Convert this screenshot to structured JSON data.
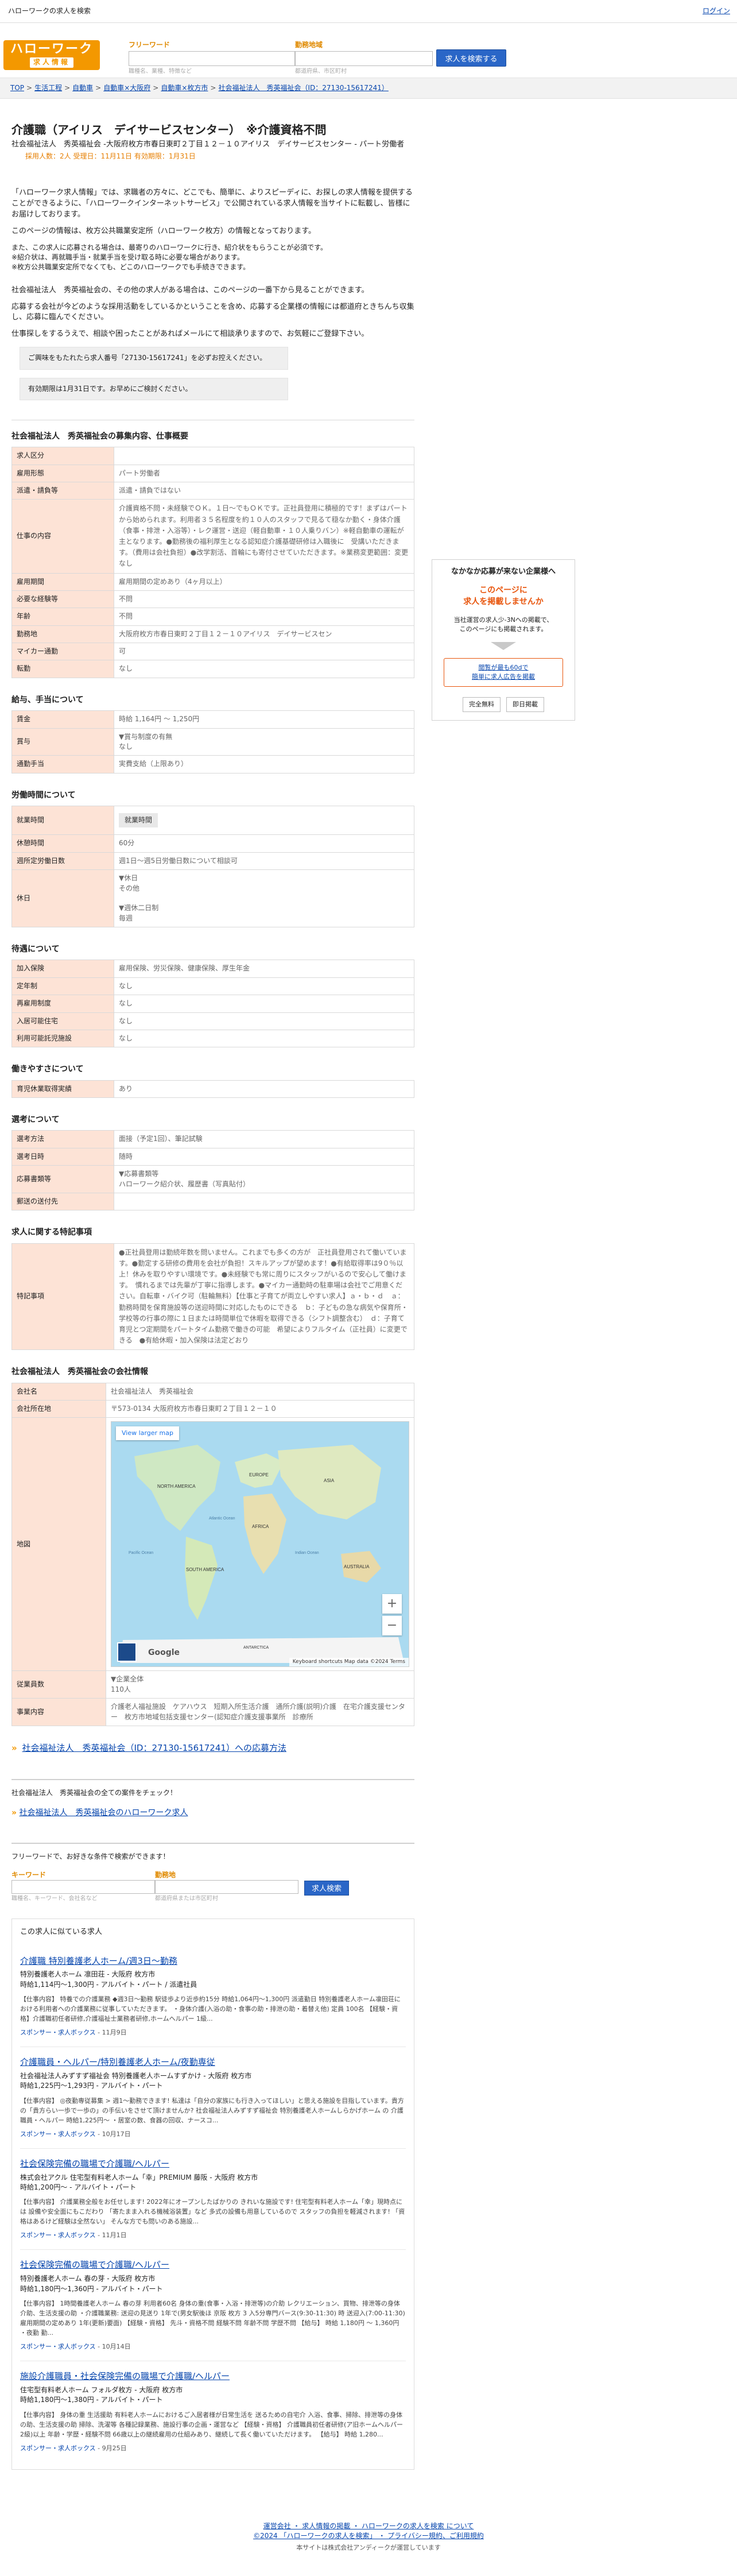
{
  "topbar": {
    "site_title": "ハローワークの求人を検索",
    "login": "ログイン"
  },
  "header": {
    "logo_line1": "ハローワーク",
    "logo_line2": "求人情報",
    "keyword_label": "フリーワード",
    "keyword_hint": "職種名、業種、特徴など",
    "area_label": "勤務地域",
    "area_hint": "都道府県、市区町村",
    "search_button": "求人を検索する"
  },
  "breadcrumb": [
    "TOP",
    "生活工程",
    "自動車",
    "自動車×大阪府",
    "自動車×枚方市",
    "社会福祉法人　秀英福祉会（ID：27130-15617241）"
  ],
  "job": {
    "title": "介護職（アイリス　デイサービスセンター）　※介護資格不問",
    "employer": "社会福祉法人　秀英福祉会 -大阪府枚方市春日東町２丁目１２－１０アイリス　デイサービスセンター - パート労働者",
    "meta_label": "採用人数：2人",
    "meta_dates": "受理日：11月11日  有効期限：1月31日"
  },
  "notice": {
    "p1": "「ハローワーク求人情報」では、求職者の方々に、どこでも、簡単に、よりスピーディに、お探しの求人情報を提供することができるように、「ハローワークインターネットサービス」で公開されている求人情報を当サイトに転載し、皆様にお届けしております。",
    "p2": "このページの情報は、枚方公共職業安定所（ハローワーク枚方）の情報となっております。",
    "p3": "また、この求人に応募される場合は、最寄りのハローワークに行き、紹介状をもらうことが必須です。",
    "p4": "※紹介状は、再就職手当・就業手当を受け取る時に必要な場合があります。",
    "p5": "※枚方公共職業安定所でなくても、どこのハローワークでも手続きできます。",
    "p6": "社会福祉法人　秀英福祉会の、その他の求人がある場合は、このページの一番下から見ることができます。",
    "p7": "応募する会社が今どのような採用活動をしているかということを含め、応募する企業様の情報には都道府ときちんち収集し、応募に臨んでください。",
    "p8": "仕事探しをするうえで、相談や困ったことがあればメールにて相談承りますので、お気軽にご登録下さい。",
    "box1": "ご興味をもたれたら求人番号「27130-15617241」を必ずお控えください。",
    "box2": "有効期限は1月31日です。お早めにご検討ください。"
  },
  "sections": {
    "overview_title": "社会福祉法人　秀英福祉会の募集内容、仕事概要",
    "overview": [
      {
        "k": "求人区分",
        "v": ""
      },
      {
        "k": "雇用形態",
        "v": "パート労働者"
      },
      {
        "k": "派遣・請負等",
        "v": "派遣・請負ではない"
      },
      {
        "k": "仕事の内容",
        "v": "介護資格不問・未経験でＯＫ。１日～でもＯＫです。正社員登用に積極的です！まずはパートから始められます。利用者３５名程度を約１０人のスタッフで見るて穏なか勤く・身体介護（食事・排泄・入浴等）・レク運営・送迎（軽自動車・１０人乗りバン）※軽自動車の運転が主となります。●勤務後の福利厚生となる認知症介護基礎研修は入職後に　受講いただきます。（費用は会社負担）●改学割活、首輪にも寄付させていただきます。※業務変更範囲：変更なし"
      },
      {
        "k": "雇用期間",
        "v": "雇用期間の定めあり（4ヶ月以上）"
      },
      {
        "k": "必要な経験等",
        "v": "不問"
      },
      {
        "k": "年齢",
        "v": "不問"
      },
      {
        "k": "勤務地",
        "v": "大阪府枚方市春日東町２丁目１２－１０アイリス　デイサービスセン"
      },
      {
        "k": "マイカー通勤",
        "v": "可"
      },
      {
        "k": "転勤",
        "v": "なし"
      }
    ],
    "pay_title": "給与、手当について",
    "pay": [
      {
        "k": "賃金",
        "v": "時給 1,164円 〜 1,250円"
      },
      {
        "k": "賞与",
        "v": "▼賞与制度の有無\nなし"
      },
      {
        "k": "通勤手当",
        "v": "実費支給（上限あり）"
      }
    ],
    "work_title": "労働時間について",
    "work": [
      {
        "k": "就業時間",
        "v": "就業時間"
      },
      {
        "k": "休憩時間",
        "v": "60分"
      },
      {
        "k": "週所定労働日数",
        "v": "週1日〜週5日労働日数について相談可"
      },
      {
        "k": "休日",
        "v": "▼休日\nその他\n\n▼週休二日制\n毎週"
      }
    ],
    "benefit_title": "待遇について",
    "benefit": [
      {
        "k": "加入保険",
        "v": "雇用保険、労災保険、健康保険、厚生年金"
      },
      {
        "k": "定年制",
        "v": "なし"
      },
      {
        "k": "再雇用制度",
        "v": "なし"
      },
      {
        "k": "入居可能住宅",
        "v": "なし"
      },
      {
        "k": "利用可能託児施設",
        "v": "なし"
      }
    ],
    "env_title": "働きやすさについて",
    "env": [
      {
        "k": "育児休業取得実績",
        "v": "あり"
      }
    ],
    "select_title": "選考について",
    "select": [
      {
        "k": "選考方法",
        "v": "面接（予定1回）、筆記試験"
      },
      {
        "k": "選考日時",
        "v": "随時"
      },
      {
        "k": "応募書類等",
        "v": "▼応募書類等\nハローワーク紹介状、履歴書（写真貼付）"
      },
      {
        "k": "郵送の送付先",
        "v": ""
      }
    ],
    "special_title": "求人に関する特記事項",
    "special": [
      {
        "k": "特記事項",
        "v": "●正社員登用は勤続年数を問いません。これまでも多くの方が　正社員登用されて働いています。●勤定する研修の費用を会社が負担！スキルアップが望めます！●有給取得率は9０％以上！休みを取りやすい環境です。●未経験でも常に周りにスタッフがいるので安心して働けます。　慣れるまでは先輩が丁寧に指導します。●マイカー通勤時の駐車場は会社でご用意ください。自転車・バイク可（駐輪無料）【仕事と子育てが両立しやすい求人】ａ・ｂ・ｄ　ａ：勤務時間を保育施設等の送迎時間に対応したものにできる　ｂ：子どもの急な病気や保育所・学校等の行事の際に１日または時間単位で休暇を取得できる（シフト調整含む）　ｄ：子育て育児とつ定期間をパートタイム勤務で働きの可能　希望によりフルタイム（正社員）に変更できる　●有給休暇・加入保険は法定どおり"
      }
    ],
    "company_title": "社会福祉法人　秀英福祉会の会社情報",
    "company": [
      {
        "k": "会社名",
        "v": "社会福祉法人　秀英福祉会"
      },
      {
        "k": "会社所在地",
        "v": "〒573-0134 大阪府枚方市春日東町２丁目１２－１０"
      },
      {
        "k": "地図",
        "v": ""
      },
      {
        "k": "従業員数",
        "v": "▼企業全体\n110人"
      },
      {
        "k": "事業内容",
        "v": "介護老人福祉施設　ケアハウス　短期入所生活介護　通所介護(説明)介護　在宅介護支援センター　枚方市地域包括支援センター(認知症介護支援事業所　診療所"
      }
    ]
  },
  "map": {
    "view_larger": "View larger map",
    "zoom_in": "+",
    "zoom_out": "−",
    "google": "Google",
    "footer": "Keyboard shortcuts   Map data ©2024   Terms",
    "labels": {
      "north_america": "NORTH AMERICA",
      "europe": "EUROPE",
      "asia": "ASIA",
      "africa": "AFRICA",
      "south_america": "SOUTH AMERICA",
      "australia": "AUSTRALIA",
      "antarctica": "ANTARCTICA",
      "atlantic": "Atlantic Ocean",
      "pacific": "Pacific Ocean",
      "indian": "Indian Ocean"
    }
  },
  "apply_link": "社会福祉法人　秀英福祉会（ID：27130-15617241）への応募方法",
  "company_other": {
    "cap": "社会福祉法人　秀英福祉会の全ての案件をチェック！",
    "link": "社会福祉法人　秀英福祉会のハローワーク求人"
  },
  "search2": {
    "cap": "フリーワードで、お好きな条件で検索ができます！",
    "kw_label": "キーワード",
    "kw_hint": "職種名、キーワード、会社名など",
    "area_label": "勤務地",
    "area_hint": "都道府県または市区町村",
    "button": "求人検索"
  },
  "similar": {
    "cap": "この求人に似ている求人",
    "jobs": [
      {
        "title": "介護職 特別養護老人ホーム/週3日〜勤務",
        "company": "特別養護老人ホーム 凛田荘 - 大阪府 枚方市",
        "salary": "時給1,114円〜1,300円 - アルバイト・パート / 派遣社員",
        "desc": "【仕事内容】 特養での介護業務 ◆週3日〜勤務 駅徒歩より近歩約15分 時給1,064円〜1,300円 派遣勤日 特別養護老人ホーム凛田荘における利用者への介護業務に従事していただきます。 ・身体介護(入浴の助・食事の助・排泄の助・着替え他) 定員 100名 【経験・資格】介護職初任者研修,介護福祉士業務者研修,ホームヘルパー 1級...",
        "sponsor": "スポンサー・",
        "source": "求人ボックス",
        "date": "- 11月9日"
      },
      {
        "title": "介護職員・ヘルパー/特別養護老人ホーム/夜勤専従",
        "company": "社会福祉法人みずすず福祉会 特別養護老人ホームすずかけ - 大阪府 枚方市",
        "salary": "時給1,225円〜1,293円 - アルバイト・パート",
        "desc": "【仕事内容】 ◎夜勤専従募集 > 週1〜勤務できます! 私達は「自分の家族にも行き入ってほしい」と思える施設を目指しています。貴方の「貴方らい一歩で一歩の」の手伝いをさせて頂けませんか? 社会福祉法人みずすず福祉会 特別養護老人ホームしらかげホーム の 介護職員・ヘルパー 時給1,225円〜 ・居室の数、食器の回収、ナースコ...",
        "sponsor": "スポンサー・",
        "source": "求人ボックス",
        "date": "- 10月17日"
      },
      {
        "title": "社会保険完備の職場で介護職/ヘルパー",
        "company": "株式会社アクル 住宅型有料老人ホーム「幸」PREMIUM 藤阪 - 大阪府 枚方市",
        "salary": "時給1,200円〜 - アルバイト・パート",
        "desc": "【仕事内容】 介護業務全般をお任せします! 2022年にオープンしたばかりの きれいな施設です! 住宅型有料老人ホーム「幸」現時点には 設備や安全面にもこだわり 「寄たまま入れる機械浴装置」など 多式の設備も用意しているので スタッフの負担を軽減されます! 「資格はあるけど経験は全然ない」 そんな方でも問いのある施設...",
        "sponsor": "スポンサー・",
        "source": "求人ボックス",
        "date": "- 11月1日"
      },
      {
        "title": "社会保険完備の職場で介護職/ヘルパー",
        "company": "特別養護老人ホーム 春の芽 - 大阪府 枚方市",
        "salary": "時給1,180円〜1,360円 - アルバイト・パート",
        "desc": "【仕事内容】 1時間養護老人ホーム 春の芽 利用者60名 身体の重(食事・入浴・排泄等)の介助 レクリエーション、買物、排泄等の身体介助、生活支援の助 ・介護職業務: 送迎の見送り 1年で(男女駅後ほ 京阪 枚方 3 入5分専門バース(9:30-11:30) 時 送迎入(7:00-11:30) 雇用期間の定めあり 1年(更新)要面) 【経験・資格】 先斗・資格不問 経験不問 年齢不問 学歴不問 【給与】 時給 1,180円 〜 1,360円 ・夜勤 勤...",
        "sponsor": "スポンサー・",
        "source": "求人ボックス",
        "date": "- 10月14日"
      },
      {
        "title": "施設介護職員・社会保険完備の職場で介護職/ヘルパー",
        "company": "住宅型有料老人ホーム フォルダ枚方 - 大阪府 枚方市",
        "salary": "時給1,180円〜1,380円 - アルバイト・パート",
        "desc": "【仕事内容】 身体の重 生活援助 有料老人ホームにおけるご入居者様が日常生活を 送るための自宅介 入浴、食事、掃除、排泄等の身体の助、生活支援の助 掃除、洗濯等 各種記録業務、施設行事の企画・運営など 【経験・資格】 介護職員初任者研修(ア旧ホームヘルパー2級)以上 年齢・学歴・経験不問 66歳以上の継続雇用の仕組みあり、継続して長く働いていただけます。 【給与】 時給 1,280...",
        "sponsor": "スポンサー・",
        "source": "求人ボックス",
        "date": "- 9月25日"
      }
    ]
  },
  "sidebar": {
    "head": "なかなか応募が来ない企業様へ",
    "red": "このページに\n求人を掲載しませんか",
    "txt": "当社運営の求人少-3Nへの掲載で、\nこのページにも掲載されます。",
    "cta": "閲覧が最も60dで\n簡単に求人広告を掲載",
    "btn1": "完全無料",
    "btn2": "即日掲載"
  },
  "footer": {
    "links": "運営会社 ・ 求人情報の掲載 ・ ハローワークの求人を検索 について",
    "copy": "©2024 「ハローワークの求人を検索」 ・ プライバシー規約、ご利用規約",
    "run": "本サイトは株式会社アンディークが運営しています"
  },
  "colors": {
    "accent": "#f39800",
    "th_bg": "#fde3d6",
    "link": "#0645ad",
    "button": "#2a66c7"
  }
}
